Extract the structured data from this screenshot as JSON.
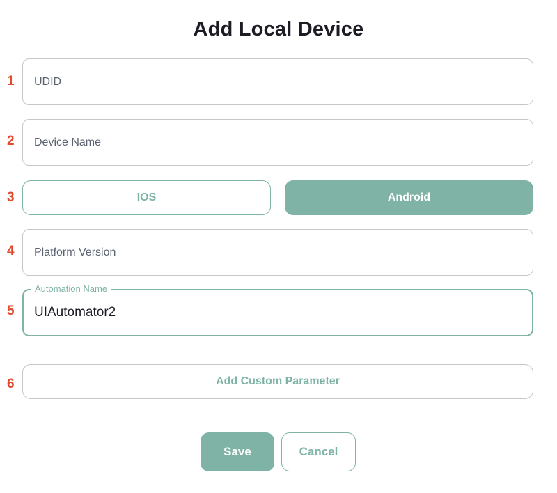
{
  "dialog": {
    "title": "Add Local Device"
  },
  "markers": [
    "1",
    "2",
    "3",
    "4",
    "5",
    "6"
  ],
  "fields": {
    "udid": {
      "placeholder": "UDID",
      "value": ""
    },
    "device_name": {
      "placeholder": "Device Name",
      "value": ""
    },
    "platform_version": {
      "placeholder": "Platform Version",
      "value": ""
    },
    "automation_name": {
      "label": "Automation Name",
      "value": "UIAutomator2"
    }
  },
  "platform": {
    "options": [
      "IOS",
      "Android"
    ],
    "selected": "Android"
  },
  "buttons": {
    "add_custom_parameter": "Add Custom Parameter",
    "save": "Save",
    "cancel": "Cancel"
  },
  "colors": {
    "accent": "#7fb3a6",
    "marker": "#e04a2f",
    "border": "#c6c6c6",
    "title": "#1c1c24"
  }
}
